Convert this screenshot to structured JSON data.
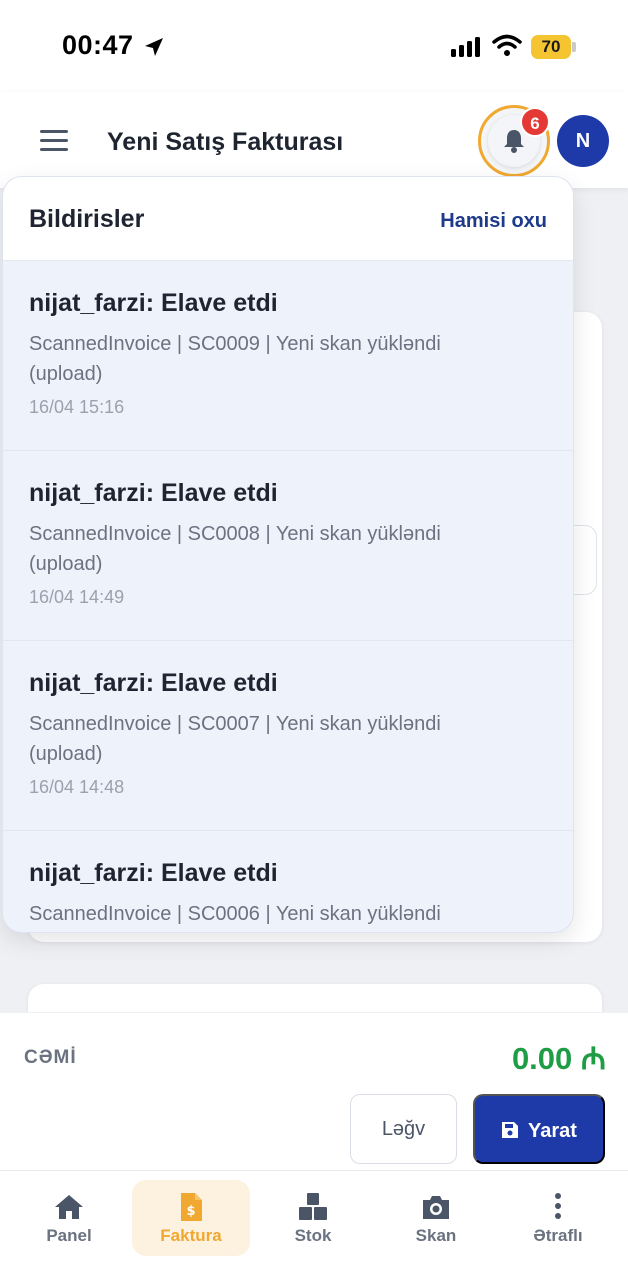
{
  "status_bar": {
    "time": "00:47",
    "battery": "70"
  },
  "header": {
    "title": "Yeni Satış Fakturası",
    "notification_count": "6",
    "avatar_initial": "N"
  },
  "notifications": {
    "title": "Bildirisler",
    "read_all_label": "Hamisi oxu",
    "items": [
      {
        "title": "nijat_farzi: Elave etdi",
        "body": "ScannedInvoice | SC0009 | Yeni skan yükləndi (upload)",
        "time": "16/04 15:16"
      },
      {
        "title": "nijat_farzi: Elave etdi",
        "body": "ScannedInvoice | SC0008 | Yeni skan yükləndi (upload)",
        "time": "16/04 14:49"
      },
      {
        "title": "nijat_farzi: Elave etdi",
        "body": "ScannedInvoice | SC0007 | Yeni skan yükləndi (upload)",
        "time": "16/04 14:48"
      },
      {
        "title": "nijat_farzi: Elave etdi",
        "body": "ScannedInvoice | SC0006 | Yeni skan yükləndi",
        "time": ""
      }
    ]
  },
  "summary": {
    "total_label": "CƏMİ",
    "total_value": "0.00 ₼",
    "cancel_label": "Ləğv",
    "create_label": "Yarat"
  },
  "tabs": [
    {
      "label": "Panel",
      "icon": "home-icon"
    },
    {
      "label": "Faktura",
      "icon": "invoice-icon"
    },
    {
      "label": "Stok",
      "icon": "boxes-icon"
    },
    {
      "label": "Skan",
      "icon": "scan-icon"
    },
    {
      "label": "Ətraflı",
      "icon": "more-icon"
    }
  ],
  "colors": {
    "primary": "#1e3aa8",
    "accent": "#f0a830",
    "success": "#1f9d45",
    "badge": "#e53935"
  }
}
